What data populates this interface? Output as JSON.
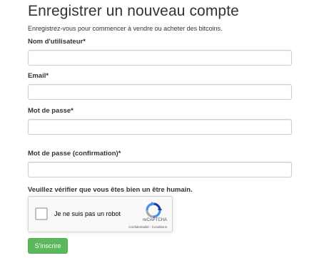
{
  "page": {
    "title": "Enregistrer un nouveau compte",
    "subtitle": "Enregistrez-vous pour commencer à vendre ou acheter des bitcoins."
  },
  "form": {
    "username": {
      "label": "Nom d'utilisateur*",
      "value": ""
    },
    "email": {
      "label": "Email*",
      "value": ""
    },
    "password": {
      "label": "Mot de passe*",
      "value": ""
    },
    "password_confirm": {
      "label": "Mot de passe (confirmation)*",
      "value": ""
    },
    "human_check_note": "Veuillez vérifier que vous êtes bien un être humain.",
    "submit_label": "S'inscrire"
  },
  "recaptcha": {
    "checkbox_label": "Je ne suis pas un robot",
    "brand": "reCAPTCHA",
    "links": "Confidentialité - Conditions",
    "checked": false,
    "logo_icon": "recaptcha-logo-icon"
  },
  "colors": {
    "submit_bg": "#5cb85c",
    "recaptcha_blue": "#1c3aa9",
    "recaptcha_light_blue": "#4a90e2",
    "recaptcha_gray": "#a6a6a6"
  }
}
